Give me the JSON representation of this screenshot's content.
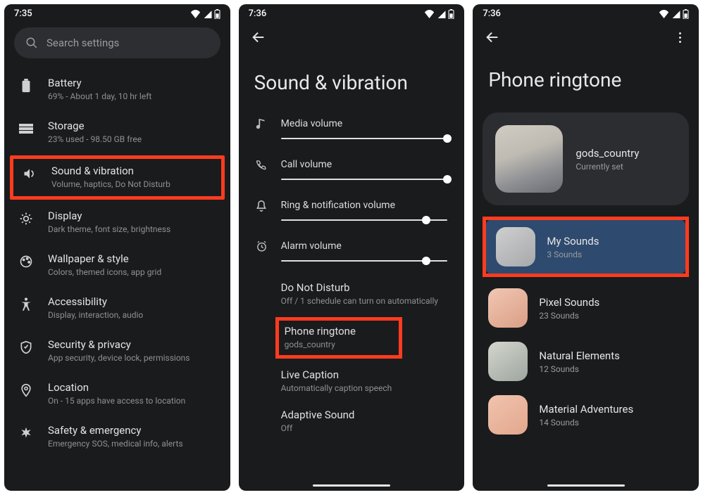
{
  "screen1": {
    "time": "7:35",
    "search_placeholder": "Search settings",
    "items": [
      {
        "title": "Battery",
        "subtitle": "69% - About 1 day, 10 hr left"
      },
      {
        "title": "Storage",
        "subtitle": "23% used - 98.50 GB free"
      },
      {
        "title": "Sound & vibration",
        "subtitle": "Volume, haptics, Do Not Disturb"
      },
      {
        "title": "Display",
        "subtitle": "Dark theme, font size, brightness"
      },
      {
        "title": "Wallpaper & style",
        "subtitle": "Colors, themed icons, app grid"
      },
      {
        "title": "Accessibility",
        "subtitle": "Display, interaction, audio"
      },
      {
        "title": "Security & privacy",
        "subtitle": "App security, device lock, permissions"
      },
      {
        "title": "Location",
        "subtitle": "On - 15 apps have access to location"
      },
      {
        "title": "Safety & emergency",
        "subtitle": "Emergency SOS, medical info, alerts"
      }
    ]
  },
  "screen2": {
    "time": "7:36",
    "title": "Sound & vibration",
    "sliders": [
      {
        "label": "Media volume",
        "pct": 100
      },
      {
        "label": "Call volume",
        "pct": 100
      },
      {
        "label": "Ring & notification volume",
        "pct": 87
      },
      {
        "label": "Alarm volume",
        "pct": 87
      }
    ],
    "settings": {
      "dnd": {
        "title": "Do Not Disturb",
        "subtitle": "Off / 1 schedule can turn on automatically"
      },
      "ringtone": {
        "title": "Phone ringtone",
        "subtitle": "gods_country"
      },
      "live": {
        "title": "Live Caption",
        "subtitle": "Automatically caption speech"
      },
      "adaptive": {
        "title": "Adaptive Sound",
        "subtitle": "Off"
      }
    }
  },
  "screen3": {
    "time": "7:36",
    "title": "Phone ringtone",
    "current": {
      "name": "gods_country",
      "status": "Currently set"
    },
    "categories": [
      {
        "name": "My Sounds",
        "count": "3 Sounds"
      },
      {
        "name": "Pixel Sounds",
        "count": "23 Sounds"
      },
      {
        "name": "Natural Elements",
        "count": "12 Sounds"
      },
      {
        "name": "Material Adventures",
        "count": "14 Sounds"
      }
    ]
  }
}
